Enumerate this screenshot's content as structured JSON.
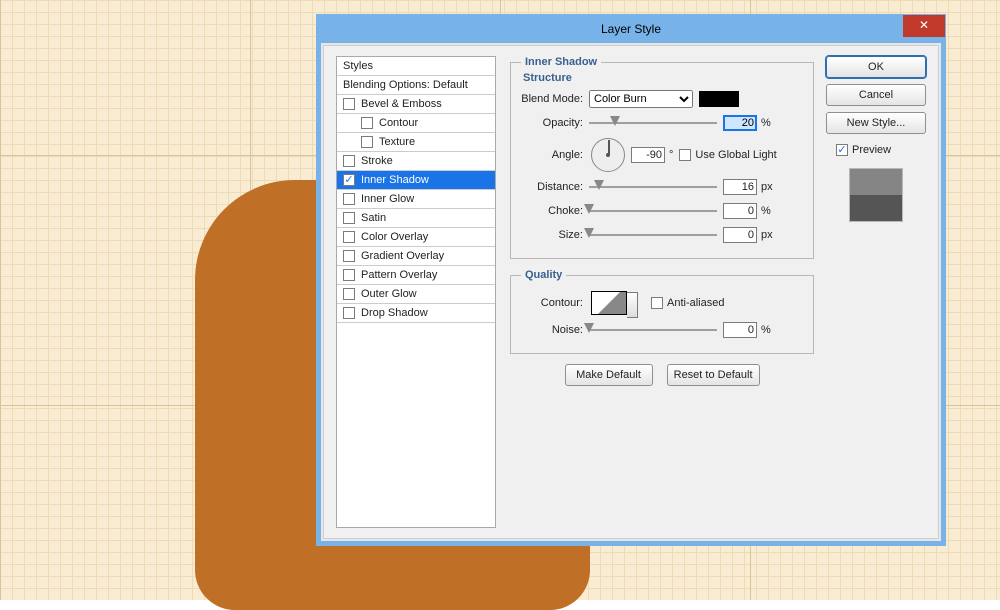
{
  "dialog": {
    "title": "Layer Style"
  },
  "sidebar": {
    "header": "Styles",
    "blending": "Blending Options: Default",
    "items": [
      {
        "label": "Bevel & Emboss",
        "checked": false,
        "selected": false,
        "indent": false
      },
      {
        "label": "Contour",
        "checked": false,
        "selected": false,
        "indent": true
      },
      {
        "label": "Texture",
        "checked": false,
        "selected": false,
        "indent": true
      },
      {
        "label": "Stroke",
        "checked": false,
        "selected": false,
        "indent": false
      },
      {
        "label": "Inner Shadow",
        "checked": true,
        "selected": true,
        "indent": false
      },
      {
        "label": "Inner Glow",
        "checked": false,
        "selected": false,
        "indent": false
      },
      {
        "label": "Satin",
        "checked": false,
        "selected": false,
        "indent": false
      },
      {
        "label": "Color Overlay",
        "checked": false,
        "selected": false,
        "indent": false
      },
      {
        "label": "Gradient Overlay",
        "checked": false,
        "selected": false,
        "indent": false
      },
      {
        "label": "Pattern Overlay",
        "checked": false,
        "selected": false,
        "indent": false
      },
      {
        "label": "Outer Glow",
        "checked": false,
        "selected": false,
        "indent": false
      },
      {
        "label": "Drop Shadow",
        "checked": false,
        "selected": false,
        "indent": false
      }
    ]
  },
  "panel": {
    "title": "Inner Shadow",
    "structure_title": "Structure",
    "blend_mode_label": "Blend Mode:",
    "blend_mode_value": "Color Burn",
    "color": "#000000",
    "opacity_label": "Opacity:",
    "opacity_value": "20",
    "opacity_unit": "%",
    "angle_label": "Angle:",
    "angle_value": "-90",
    "angle_unit": "°",
    "use_global_light_label": "Use Global Light",
    "use_global_light_checked": false,
    "distance_label": "Distance:",
    "distance_value": "16",
    "distance_unit": "px",
    "choke_label": "Choke:",
    "choke_value": "0",
    "choke_unit": "%",
    "size_label": "Size:",
    "size_value": "0",
    "size_unit": "px",
    "quality_title": "Quality",
    "contour_label": "Contour:",
    "anti_aliased_label": "Anti-aliased",
    "anti_aliased_checked": false,
    "noise_label": "Noise:",
    "noise_value": "0",
    "noise_unit": "%",
    "make_default": "Make Default",
    "reset_default": "Reset to Default"
  },
  "right": {
    "ok": "OK",
    "cancel": "Cancel",
    "new_style": "New Style...",
    "preview_label": "Preview",
    "preview_checked": true
  }
}
